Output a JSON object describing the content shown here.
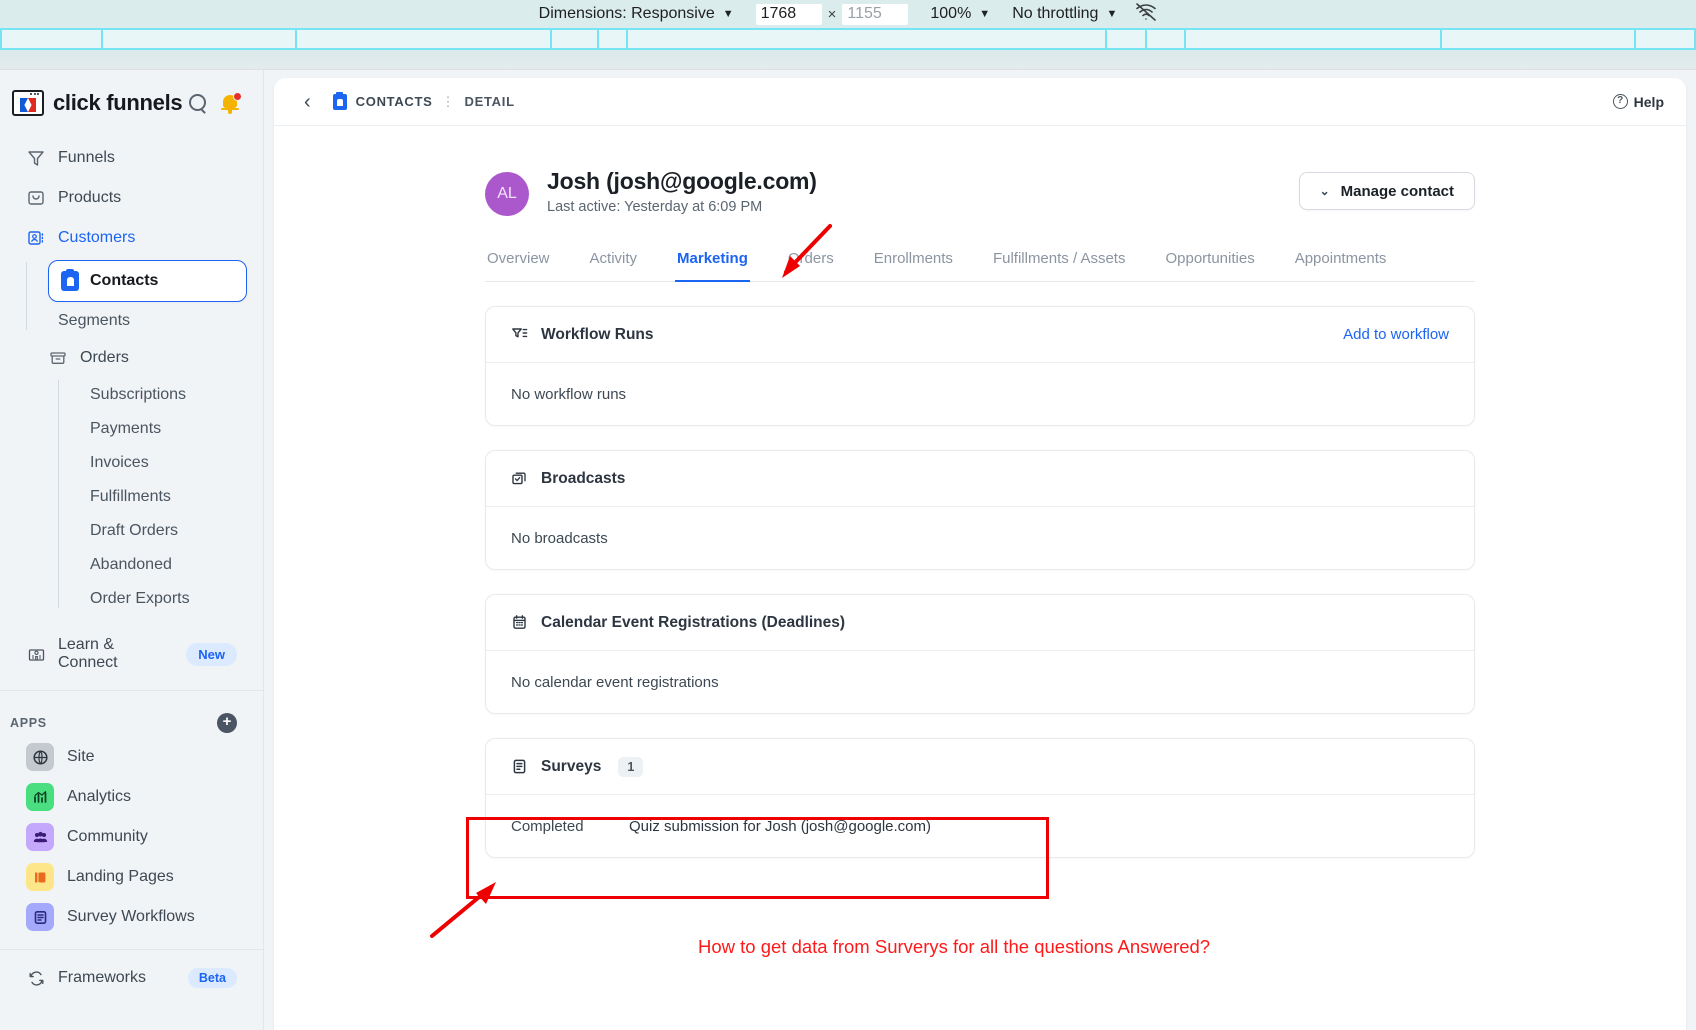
{
  "devtools": {
    "dimensions_label": "Dimensions: Responsive",
    "width_value": "1768",
    "times_symbol": "×",
    "height_value": "1155",
    "zoom_value": "100%",
    "throttling_value": "No throttling",
    "caret": "▼",
    "wifi_icon": "wifi-off-icon"
  },
  "sidebar": {
    "brand": "click funnels",
    "search_icon": "search-icon",
    "bell_icon": "notification-bell-icon",
    "nav": [
      {
        "label": "Funnels",
        "icon": "funnel-icon",
        "active": false
      },
      {
        "label": "Products",
        "icon": "products-box-icon",
        "active": false
      },
      {
        "label": "Customers",
        "icon": "customers-card-icon",
        "active": true
      }
    ],
    "contacts_item": {
      "label": "Contacts",
      "icon": "contact-badge-icon"
    },
    "segments_item": {
      "label": "Segments"
    },
    "orders_group": {
      "label": "Orders",
      "icon": "orders-archive-icon"
    },
    "orders_children": [
      {
        "label": "Subscriptions"
      },
      {
        "label": "Payments"
      },
      {
        "label": "Invoices"
      },
      {
        "label": "Fulfillments"
      },
      {
        "label": "Draft Orders"
      },
      {
        "label": "Abandoned"
      },
      {
        "label": "Order Exports"
      }
    ],
    "learn_connect": {
      "label": "Learn & Connect",
      "icon": "building-icon",
      "badge": "New"
    },
    "apps_header": {
      "title": "APPS",
      "add_icon": "plus-circle-icon"
    },
    "apps": [
      {
        "label": "Site",
        "icon": "globe-icon",
        "color": "#c4c9d0"
      },
      {
        "label": "Analytics",
        "icon": "bar-chart-icon",
        "color": "#4ade80"
      },
      {
        "label": "Community",
        "icon": "people-icon",
        "color": "#c4a8fb"
      },
      {
        "label": "Landing Pages",
        "icon": "pages-icon",
        "color": "#fde68a"
      },
      {
        "label": "Survey Workflows",
        "icon": "survey-doc-icon",
        "color": "#a5a9fb"
      }
    ],
    "frameworks": {
      "label": "Frameworks",
      "icon": "frameworks-icon",
      "badge": "Beta"
    }
  },
  "header": {
    "back_icon": "back-chevron-icon",
    "breadcrumb_icon": "contacts-icon",
    "breadcrumb_root": "CONTACTS",
    "breadcrumb_sep": "⋮",
    "breadcrumb_current": "DETAIL",
    "help_label": "Help",
    "help_icon": "help-circle-icon"
  },
  "contact": {
    "avatar_initials": "AL",
    "avatar_color": "#ab58cd",
    "name": "Josh (josh@google.com)",
    "last_active": "Last active: Yesterday at 6:09 PM",
    "manage_button": "Manage contact",
    "manage_chevron_icon": "chevron-down-icon"
  },
  "tabs": [
    {
      "label": "Overview",
      "active": false
    },
    {
      "label": "Activity",
      "active": false
    },
    {
      "label": "Marketing",
      "active": true
    },
    {
      "label": "Orders",
      "active": false
    },
    {
      "label": "Enrollments",
      "active": false
    },
    {
      "label": "Fulfillments / Assets",
      "active": false
    },
    {
      "label": "Opportunities",
      "active": false
    },
    {
      "label": "Appointments",
      "active": false
    }
  ],
  "cards": {
    "workflow_runs": {
      "title": "Workflow Runs",
      "icon": "workflow-filter-icon",
      "action": "Add to workflow",
      "empty": "No workflow runs"
    },
    "broadcasts": {
      "title": "Broadcasts",
      "icon": "broadcast-icon",
      "empty": "No broadcasts"
    },
    "calendar": {
      "title": "Calendar Event Registrations (Deadlines)",
      "icon": "calendar-icon",
      "empty": "No calendar event registrations"
    },
    "surveys": {
      "title": "Surveys",
      "icon": "survey-icon",
      "count": "1",
      "row": {
        "status": "Completed",
        "description": "Quiz submission for Josh (josh@google.com)"
      }
    }
  },
  "annotation": {
    "question": "How to get data from Surverys for all the questions Answered?",
    "color": "#ff1a1a"
  },
  "colors": {
    "accent_blue": "#1c64f2",
    "annotation_red": "#ee0000",
    "grid_cyan": "#76e4f3"
  }
}
